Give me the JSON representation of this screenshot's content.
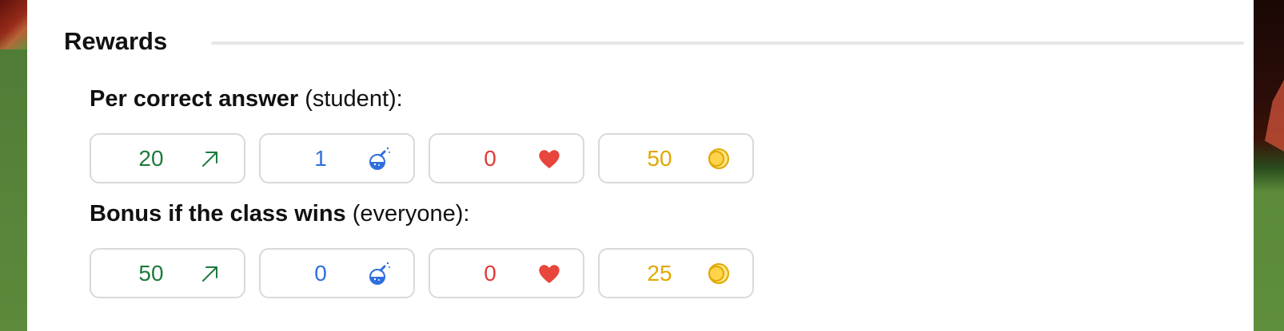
{
  "section": {
    "title": "Rewards"
  },
  "per_correct": {
    "label_bold": "Per correct answer",
    "label_note": " (student):",
    "rewards": [
      {
        "value": "20",
        "icon": "xp-arrow-icon",
        "color": "#1e7a3c"
      },
      {
        "value": "1",
        "icon": "potion-icon",
        "color": "#2f6fdf"
      },
      {
        "value": "0",
        "icon": "heart-icon",
        "color": "#e03a3a"
      },
      {
        "value": "50",
        "icon": "gold-coin-icon",
        "color": "#e0a800"
      }
    ]
  },
  "class_bonus": {
    "label_bold": "Bonus if the class wins",
    "label_note": " (everyone):",
    "rewards": [
      {
        "value": "50",
        "icon": "xp-arrow-icon",
        "color": "#1e7a3c"
      },
      {
        "value": "0",
        "icon": "potion-icon",
        "color": "#2f6fdf"
      },
      {
        "value": "0",
        "icon": "heart-icon",
        "color": "#e03a3a"
      },
      {
        "value": "25",
        "icon": "gold-coin-icon",
        "color": "#e0a800"
      }
    ]
  }
}
